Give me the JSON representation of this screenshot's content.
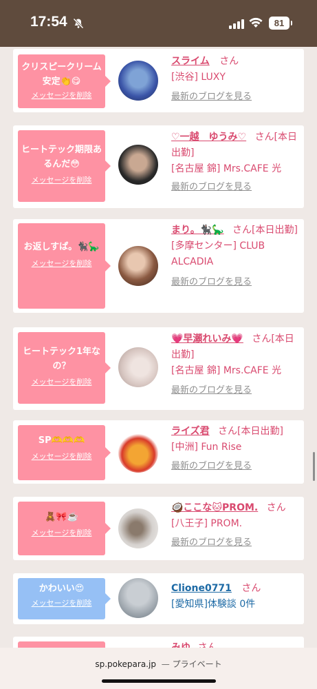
{
  "status_bar": {
    "time": "17:54",
    "battery": "81"
  },
  "cards": [
    {
      "message": "クリスピークリーム安定👏😋",
      "delete_label": "メッセージを削除",
      "name": "スライム",
      "san": "さん",
      "shop": "[渋谷] LUXY",
      "blog": "最新のブログを見る",
      "bubble_color": "#fe92a3",
      "avatar_colors": [
        "#3b55a8",
        "#7fa3d6"
      ]
    },
    {
      "message": "ヒートテック期限あるんだ😳",
      "delete_label": "メッセージを削除",
      "name": "♡一越　ゆうみ♡",
      "san": "さん[本日出勤]",
      "shop": "[名古屋 錦] Mrs.CAFE 光",
      "blog": "最新のブログを見る",
      "bubble_color": "#fe92a3",
      "avatar_colors": [
        "#2a2a2a",
        "#c9a892"
      ]
    },
    {
      "message": "お返しすぱ。🐈‍⬛🦕",
      "delete_label": "メッセージを削除",
      "name": "まり。🐈‍⬛🦕",
      "san": "さん[本日出勤]",
      "shop": "[多摩センター] CLUB ALCADIA",
      "blog": "最新のブログを見る",
      "bubble_color": "#fe92a3",
      "avatar_colors": [
        "#5a3a2c",
        "#e8c7b0"
      ]
    },
    {
      "message": "ヒートテック1年なの？",
      "delete_label": "メッセージを削除",
      "name": "💗早瀬れいみ💗",
      "san": "さん[本日出勤]",
      "shop": "[名古屋 錦] Mrs.CAFE 光",
      "blog": "最新のブログを見る",
      "bubble_color": "#fe92a3",
      "avatar_colors": [
        "#d8c7c2",
        "#efe4e0"
      ]
    },
    {
      "message": "SP🫶🫶🫶",
      "delete_label": "メッセージを削除",
      "name": "ライズ君",
      "san": "さん[本日出勤]",
      "shop": "[中洲] Fun Rise",
      "blog": "最新のブログを見る",
      "bubble_color": "#fe92a3",
      "avatar_colors": [
        "#f3a533",
        "#d83a2a"
      ]
    },
    {
      "message": "🧸🎀☕️",
      "delete_label": "メッセージを削除",
      "name": "🥥ここな🐱PROM.",
      "san": "さん",
      "shop": "[八王子] PROM.",
      "blog": "最新のブログを見る",
      "bubble_color": "#fe92a3",
      "avatar_colors": [
        "#d6d2cf",
        "#8a7a6c"
      ]
    },
    {
      "message": "かわいい😍",
      "delete_label": "メッセージを削除",
      "name": "Clione0771",
      "san": "さん",
      "shop": "[愛知県]体験談 0件",
      "blog": "",
      "bubble_color": "#96c0f5",
      "avatar_colors": [
        "#c9ced3",
        "#8e979f"
      ]
    },
    {
      "message": "",
      "delete_label": "",
      "name": "みゆ",
      "san": "さん",
      "shop": "",
      "blog": "",
      "bubble_color": "#fe92a3",
      "avatar_colors": [
        "#ffffff",
        "#ffffff"
      ]
    }
  ],
  "browser_bar": {
    "domain": "sp.pokepara.jp",
    "separator": "—",
    "mode": "プライベート"
  },
  "colors": {
    "pink": "#fe92a3",
    "blue_bubble": "#96c0f5",
    "name_pink": "#d94a6f",
    "name_blue": "#1d6aa5",
    "header_brown": "#5f4b3d"
  }
}
